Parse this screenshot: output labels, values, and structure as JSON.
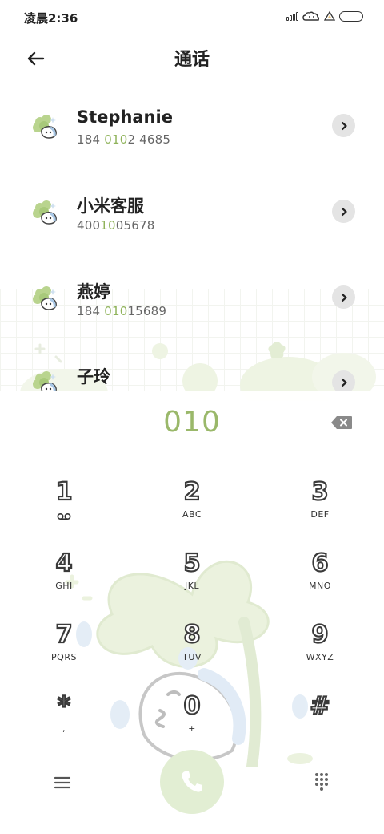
{
  "status_bar": {
    "time": "凌晨2:36"
  },
  "header": {
    "title": "通话"
  },
  "contacts": [
    {
      "name": "Stephanie",
      "number_parts": [
        "184 ",
        "010",
        "2 4685"
      ]
    },
    {
      "name": "小米客服",
      "number_parts": [
        "400",
        "10",
        "05678"
      ]
    },
    {
      "name": "燕婷",
      "number_parts": [
        "184 ",
        "010",
        "15689"
      ]
    },
    {
      "name": "子玲",
      "number_parts": [
        "",
        "",
        ""
      ]
    }
  ],
  "dial": {
    "input": "010"
  },
  "keypad": {
    "keys": [
      {
        "digit": "1",
        "letters": ""
      },
      {
        "digit": "2",
        "letters": "ABC"
      },
      {
        "digit": "3",
        "letters": "DEF"
      },
      {
        "digit": "4",
        "letters": "GHI"
      },
      {
        "digit": "5",
        "letters": "JKL"
      },
      {
        "digit": "6",
        "letters": "MNO"
      },
      {
        "digit": "7",
        "letters": "PQRS"
      },
      {
        "digit": "8",
        "letters": "TUV"
      },
      {
        "digit": "9",
        "letters": "WXYZ"
      },
      {
        "digit": "*",
        "letters": ","
      },
      {
        "digit": "0",
        "letters": "+"
      },
      {
        "digit": "#",
        "letters": ""
      }
    ]
  },
  "icons": {
    "voicemail": "voicemail-icon",
    "back": "back-arrow-icon",
    "detail": "chevron-right-icon",
    "backspace": "backspace-icon",
    "call": "phone-icon",
    "menu": "menu-icon",
    "dialpad": "dialpad-icon"
  },
  "colors": {
    "accent": "#9ab86a",
    "match_highlight": "#8fb35a",
    "call_button": "#e2eed3"
  }
}
